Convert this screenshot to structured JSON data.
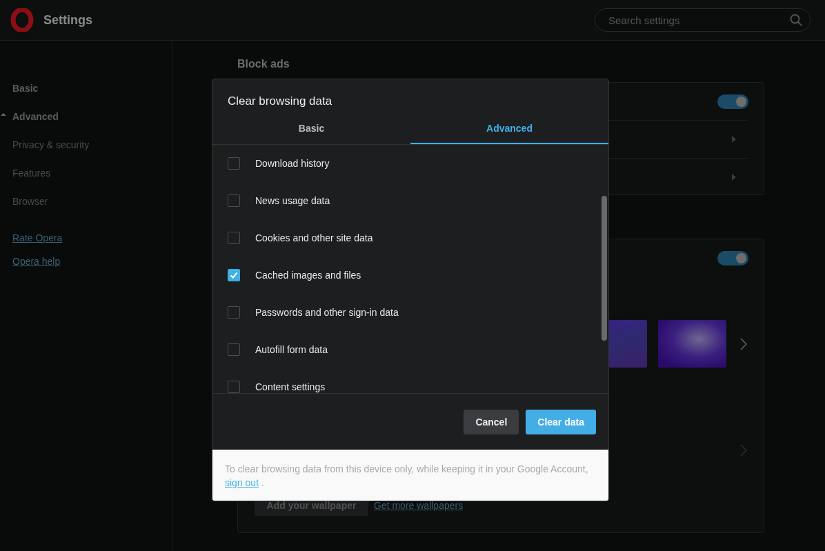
{
  "header": {
    "title": "Settings",
    "search": {
      "placeholder": "Search settings"
    }
  },
  "sidebar": {
    "items": [
      {
        "label": "Basic",
        "kind": "section"
      },
      {
        "label": "Advanced",
        "kind": "section",
        "expanded": true
      },
      {
        "label": "Privacy & security",
        "kind": "item"
      },
      {
        "label": "Features",
        "kind": "item"
      },
      {
        "label": "Browser",
        "kind": "item"
      }
    ],
    "links": [
      "Rate Opera",
      "Opera help"
    ]
  },
  "main": {
    "heading": "Block ads",
    "block_ads_card": {
      "toggle": {
        "on": true
      }
    },
    "wallpaper_card": {
      "toggle": {
        "on": true
      },
      "add_button": "Add your wallpaper",
      "more_link": "Get more wallpapers"
    }
  },
  "dialog": {
    "title": "Clear browsing data",
    "tabs": [
      {
        "label": "Basic",
        "selected": false
      },
      {
        "label": "Advanced",
        "selected": true
      }
    ],
    "items": [
      {
        "label": "Download history",
        "checked": false
      },
      {
        "label": "News usage data",
        "checked": false
      },
      {
        "label": "Cookies and other site data",
        "checked": false
      },
      {
        "label": "Cached images and files",
        "checked": true
      },
      {
        "label": "Passwords and other sign-in data",
        "checked": false
      },
      {
        "label": "Autofill form data",
        "checked": false
      },
      {
        "label": "Content settings",
        "checked": false
      }
    ],
    "buttons": [
      {
        "label": "Cancel",
        "kind": "secondary"
      },
      {
        "label": "Clear data",
        "kind": "primary"
      }
    ],
    "note": {
      "text": "To clear browsing data from this device only, while keeping it in your Google Account,",
      "link": "sign out",
      "end": "."
    }
  }
}
